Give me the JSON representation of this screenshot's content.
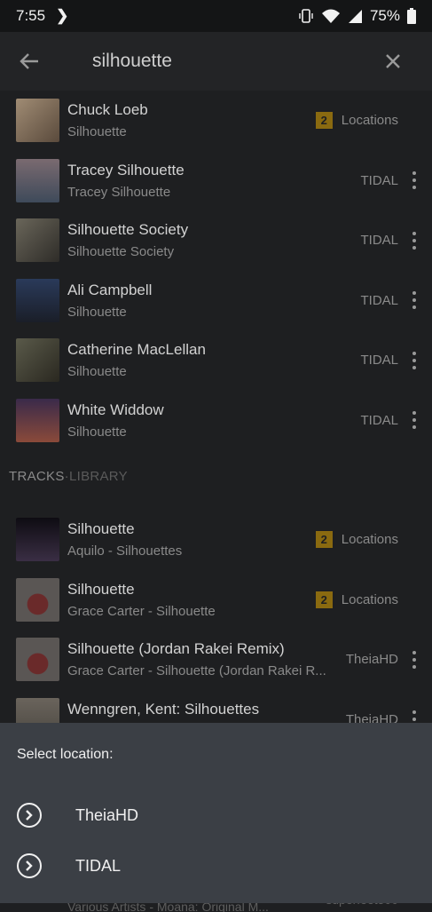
{
  "status": {
    "time": "7:55",
    "battery": "75%"
  },
  "search": {
    "query": "silhouette"
  },
  "artists": [
    {
      "title": "Chuck Loeb",
      "subtitle": "Silhouette",
      "badge": "2",
      "source": "Locations",
      "thumb_color": "#7a6a58"
    },
    {
      "title": "Tracey Silhouette",
      "subtitle": "Tracey Silhouette",
      "source": "TIDAL",
      "thumb_color": "#5a4f58"
    },
    {
      "title": "Silhouette Society",
      "subtitle": "Silhouette Society",
      "source": "TIDAL",
      "thumb_color": "#3e3c36"
    },
    {
      "title": "Ali Campbell",
      "subtitle": "Silhouette",
      "source": "TIDAL",
      "thumb_color": "#2a3240"
    },
    {
      "title": "Catherine MacLellan",
      "subtitle": "Silhouette",
      "source": "TIDAL",
      "thumb_color": "#3b3a30"
    },
    {
      "title": "White Widdow",
      "subtitle": "Silhouette",
      "source": "TIDAL",
      "thumb_color": "#5a3a4a"
    }
  ],
  "tracks_header": {
    "label": "TRACKS",
    "sep": " · ",
    "scope": "LIBRARY"
  },
  "tracks": [
    {
      "title": "Silhouette",
      "subtitle": "Aquilo - Silhouettes",
      "badge": "2",
      "source": "Locations",
      "thumb_color": "#1c1820"
    },
    {
      "title": "Silhouette",
      "subtitle": "Grace Carter - Silhouette",
      "badge": "2",
      "source": "Locations",
      "thumb_color": "#4a4644"
    },
    {
      "title": "Silhouette (Jordan Rakei Remix)",
      "subtitle": "Grace Carter - Silhouette (Jordan Rakei R...",
      "source": "TheiaHD",
      "thumb_color": "#4a4644"
    },
    {
      "title": "Wenngren, Kent: Silhouettes",
      "subtitle": "",
      "source": "TheiaHD",
      "thumb_color": "#4a4640"
    }
  ],
  "sheet": {
    "heading": "Select location:",
    "options": [
      {
        "label": "TheiaHD"
      },
      {
        "label": "TIDAL"
      }
    ]
  },
  "peek": {
    "subtitle": "Various Artists - Moana: Original M...",
    "source": "superfoot500"
  }
}
